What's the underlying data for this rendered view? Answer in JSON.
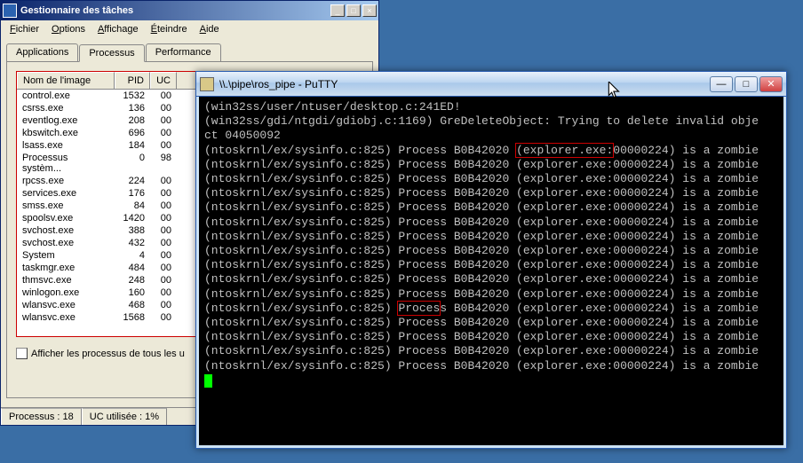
{
  "taskmgr": {
    "title": "Gestionnaire des tâches",
    "menu": [
      "Fichier",
      "Options",
      "Affichage",
      "Éteindre",
      "Aide"
    ],
    "tabs": [
      "Applications",
      "Processus",
      "Performance"
    ],
    "active_tab": 1,
    "columns": [
      "Nom de l'image",
      "PID",
      "UC"
    ],
    "rows": [
      {
        "name": "control.exe",
        "pid": "1532",
        "uc": "00"
      },
      {
        "name": "csrss.exe",
        "pid": "136",
        "uc": "00"
      },
      {
        "name": "eventlog.exe",
        "pid": "208",
        "uc": "00"
      },
      {
        "name": "kbswitch.exe",
        "pid": "696",
        "uc": "00"
      },
      {
        "name": "lsass.exe",
        "pid": "184",
        "uc": "00"
      },
      {
        "name": "Processus systèm...",
        "pid": "0",
        "uc": "98"
      },
      {
        "name": "rpcss.exe",
        "pid": "224",
        "uc": "00"
      },
      {
        "name": "services.exe",
        "pid": "176",
        "uc": "00"
      },
      {
        "name": "smss.exe",
        "pid": "84",
        "uc": "00"
      },
      {
        "name": "spoolsv.exe",
        "pid": "1420",
        "uc": "00"
      },
      {
        "name": "svchost.exe",
        "pid": "388",
        "uc": "00"
      },
      {
        "name": "svchost.exe",
        "pid": "432",
        "uc": "00"
      },
      {
        "name": "System",
        "pid": "4",
        "uc": "00"
      },
      {
        "name": "taskmgr.exe",
        "pid": "484",
        "uc": "00"
      },
      {
        "name": "thmsvc.exe",
        "pid": "248",
        "uc": "00"
      },
      {
        "name": "winlogon.exe",
        "pid": "160",
        "uc": "00"
      },
      {
        "name": "wlansvc.exe",
        "pid": "468",
        "uc": "00"
      },
      {
        "name": "wlansvc.exe",
        "pid": "1568",
        "uc": "00"
      }
    ],
    "checkbox_label": "Afficher les processus de tous les u",
    "status_left": "Processus : 18",
    "status_right": "UC utilisée :   1%"
  },
  "putty": {
    "title": "\\\\.\\pipe\\ros_pipe - PuTTY",
    "lines": [
      "(win32ss/user/ntuser/desktop.c:241ED!",
      "(win32ss/gdi/ntgdi/gdiobj.c:1169) GreDeleteObject: Trying to delete invalid obje",
      "ct 04050092",
      "(ntoskrnl/ex/sysinfo.c:825) Process B0B42020 (explorer.exe:00000224) is a zombie",
      "(ntoskrnl/ex/sysinfo.c:825) Process B0B42020 (explorer.exe:00000224) is a zombie",
      "(ntoskrnl/ex/sysinfo.c:825) Process B0B42020 (explorer.exe:00000224) is a zombie",
      "(ntoskrnl/ex/sysinfo.c:825) Process B0B42020 (explorer.exe:00000224) is a zombie",
      "(ntoskrnl/ex/sysinfo.c:825) Process B0B42020 (explorer.exe:00000224) is a zombie",
      "(ntoskrnl/ex/sysinfo.c:825) Process B0B42020 (explorer.exe:00000224) is a zombie",
      "(ntoskrnl/ex/sysinfo.c:825) Process B0B42020 (explorer.exe:00000224) is a zombie",
      "(ntoskrnl/ex/sysinfo.c:825) Process B0B42020 (explorer.exe:00000224) is a zombie",
      "(ntoskrnl/ex/sysinfo.c:825) Process B0B42020 (explorer.exe:00000224) is a zombie",
      "(ntoskrnl/ex/sysinfo.c:825) Process B0B42020 (explorer.exe:00000224) is a zombie",
      "(ntoskrnl/ex/sysinfo.c:825) Process B0B42020 (explorer.exe:00000224) is a zombie",
      "(ntoskrnl/ex/sysinfo.c:825) Process B0B42020 (explorer.exe:00000224) is a zombie",
      "(ntoskrnl/ex/sysinfo.c:825) Process B0B42020 (explorer.exe:00000224) is a zombie",
      "(ntoskrnl/ex/sysinfo.c:825) Process B0B42020 (explorer.exe:00000224) is a zombie",
      "(ntoskrnl/ex/sysinfo.c:825) Process B0B42020 (explorer.exe:00000224) is a zombie",
      "(ntoskrnl/ex/sysinfo.c:825) Process B0B42020 (explorer.exe:00000224) is a zombie"
    ],
    "highlight_line1_idx": 3,
    "highlight_text1": "(explorer.exe:",
    "highlight_line2_idx": 14,
    "highlight_text2": "Proces"
  }
}
